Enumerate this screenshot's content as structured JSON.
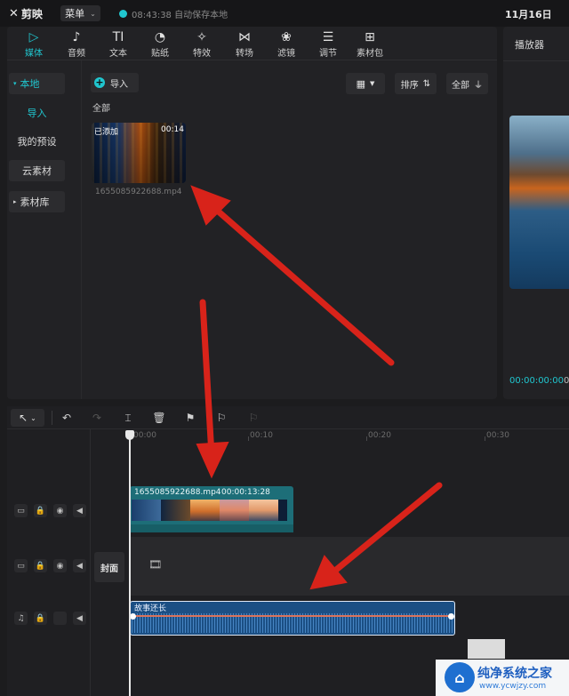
{
  "app": {
    "name": "剪映",
    "menu_label": "菜单",
    "autosave": "08:43:38 自动保存本地",
    "date": "11月16日"
  },
  "media_tabs": [
    {
      "label": "媒体",
      "icon": "▷",
      "icon_name": "media-icon",
      "active": true
    },
    {
      "label": "音频",
      "icon": "♪",
      "icon_name": "audio-icon"
    },
    {
      "label": "文本",
      "icon": "TI",
      "icon_name": "text-icon"
    },
    {
      "label": "贴纸",
      "icon": "◔",
      "icon_name": "sticker-icon"
    },
    {
      "label": "特效",
      "icon": "✧",
      "icon_name": "effects-icon"
    },
    {
      "label": "转场",
      "icon": "⋈",
      "icon_name": "transition-icon"
    },
    {
      "label": "滤镜",
      "icon": "❀",
      "icon_name": "filter-icon"
    },
    {
      "label": "调节",
      "icon": "☰",
      "icon_name": "adjust-icon"
    },
    {
      "label": "素材包",
      "icon": "⊞",
      "icon_name": "asset-pack-icon"
    }
  ],
  "left_nav": {
    "local": "本地",
    "import": "导入",
    "my_presets": "我的预设",
    "cloud": "云素材",
    "library": "素材库"
  },
  "toolbar": {
    "import_label": "导入",
    "sort_label": "排序",
    "all_filter_label": "全部"
  },
  "media": {
    "section_label": "全部",
    "added_tag": "已添加",
    "duration": "00:14",
    "filename": "1655085922688.mp4"
  },
  "player": {
    "title": "播放器",
    "current_time": "00:00:00:00",
    "total_time_partial": "00"
  },
  "timeline": {
    "ticks": [
      "00:00",
      "00:10",
      "00:20",
      "00:30"
    ],
    "video_clip": {
      "name": "1655085922688.mp4",
      "duration": "00:00:13:28"
    },
    "cover_label": "封面",
    "audio_clip": {
      "name": "故事还长"
    }
  },
  "watermark": {
    "title": "纯净系统之家",
    "url": "www.ycwjzy.com"
  },
  "colors": {
    "accent": "#20c6cf",
    "arrow": "#d8231a"
  }
}
